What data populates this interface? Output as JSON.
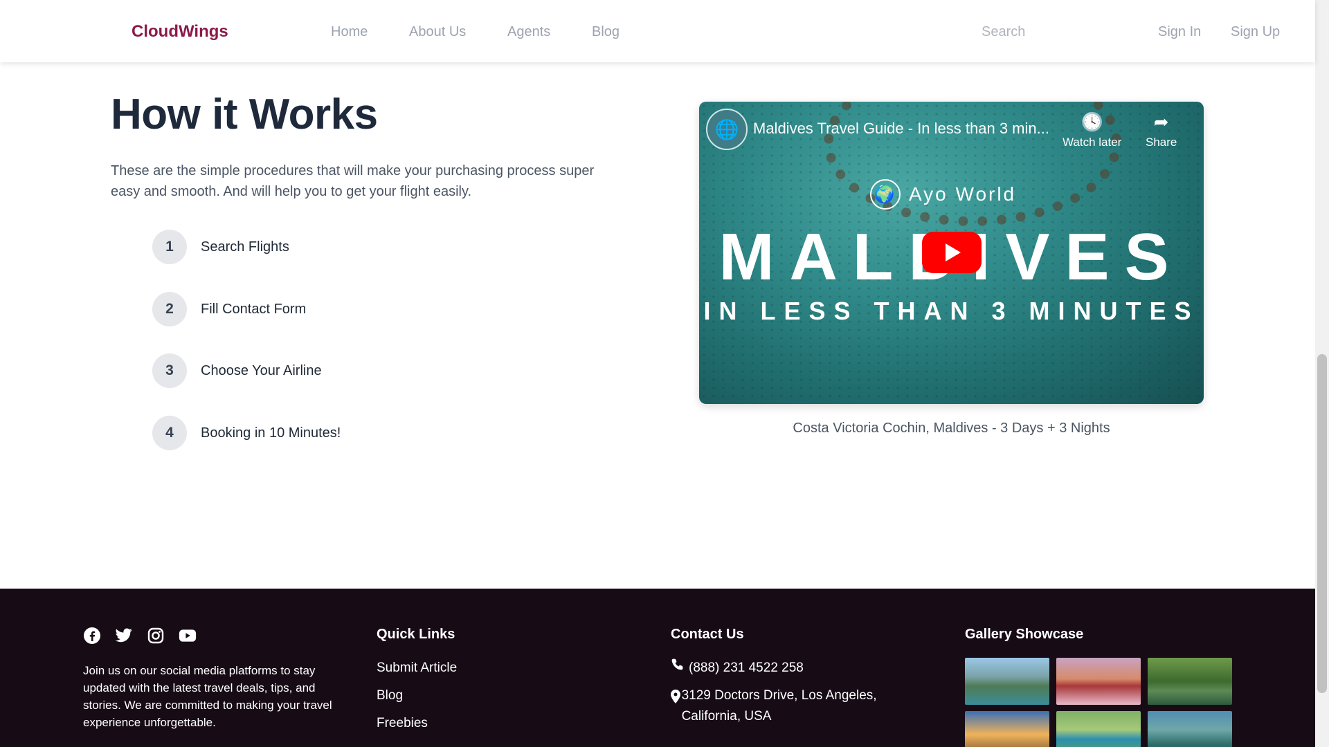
{
  "header": {
    "logo": "CloudWings",
    "nav": [
      "Home",
      "About Us",
      "Agents",
      "Blog"
    ],
    "search_placeholder": "Search",
    "sign_in": "Sign In",
    "sign_up": "Sign Up"
  },
  "how_it_works": {
    "title": "How it Works",
    "description": "These are the simple procedures that will make your purchasing process super easy and smooth. And will help you to get your flight easily.",
    "steps": [
      {
        "num": "1",
        "label": "Search Flights"
      },
      {
        "num": "2",
        "label": "Fill Contact Form"
      },
      {
        "num": "3",
        "label": "Choose Your Airline"
      },
      {
        "num": "4",
        "label": "Booking in 10 Minutes!"
      }
    ]
  },
  "video": {
    "title": "Maldives Travel Guide - In less than 3 min...",
    "watch_later": "Watch later",
    "share": "Share",
    "brand": "Ayo World",
    "big_text": "MALDIVES",
    "sub_text": "IN LESS THAN 3 MINUTES",
    "caption": "Costa Victoria Cochin, Maldives - 3 Days + 3 Nights"
  },
  "footer": {
    "social_icons": [
      "facebook-icon",
      "twitter-icon",
      "instagram-icon",
      "youtube-icon"
    ],
    "about_text": "Join us on our social media platforms to stay updated with the latest travel deals, tips, and stories. We are committed to making your travel experience unforgettable.",
    "quick_links_title": "Quick Links",
    "quick_links": [
      "Submit Article",
      "Blog",
      "Freebies"
    ],
    "contact_title": "Contact Us",
    "phone": "(888) 231 4522 258",
    "address": "3129 Doctors Drive, Los Angeles, California, USA",
    "gallery_title": "Gallery Showcase"
  },
  "colors": {
    "brand": "#8b1a4a",
    "footer_bg": "#170c16",
    "youtube_red": "#ff0000"
  }
}
